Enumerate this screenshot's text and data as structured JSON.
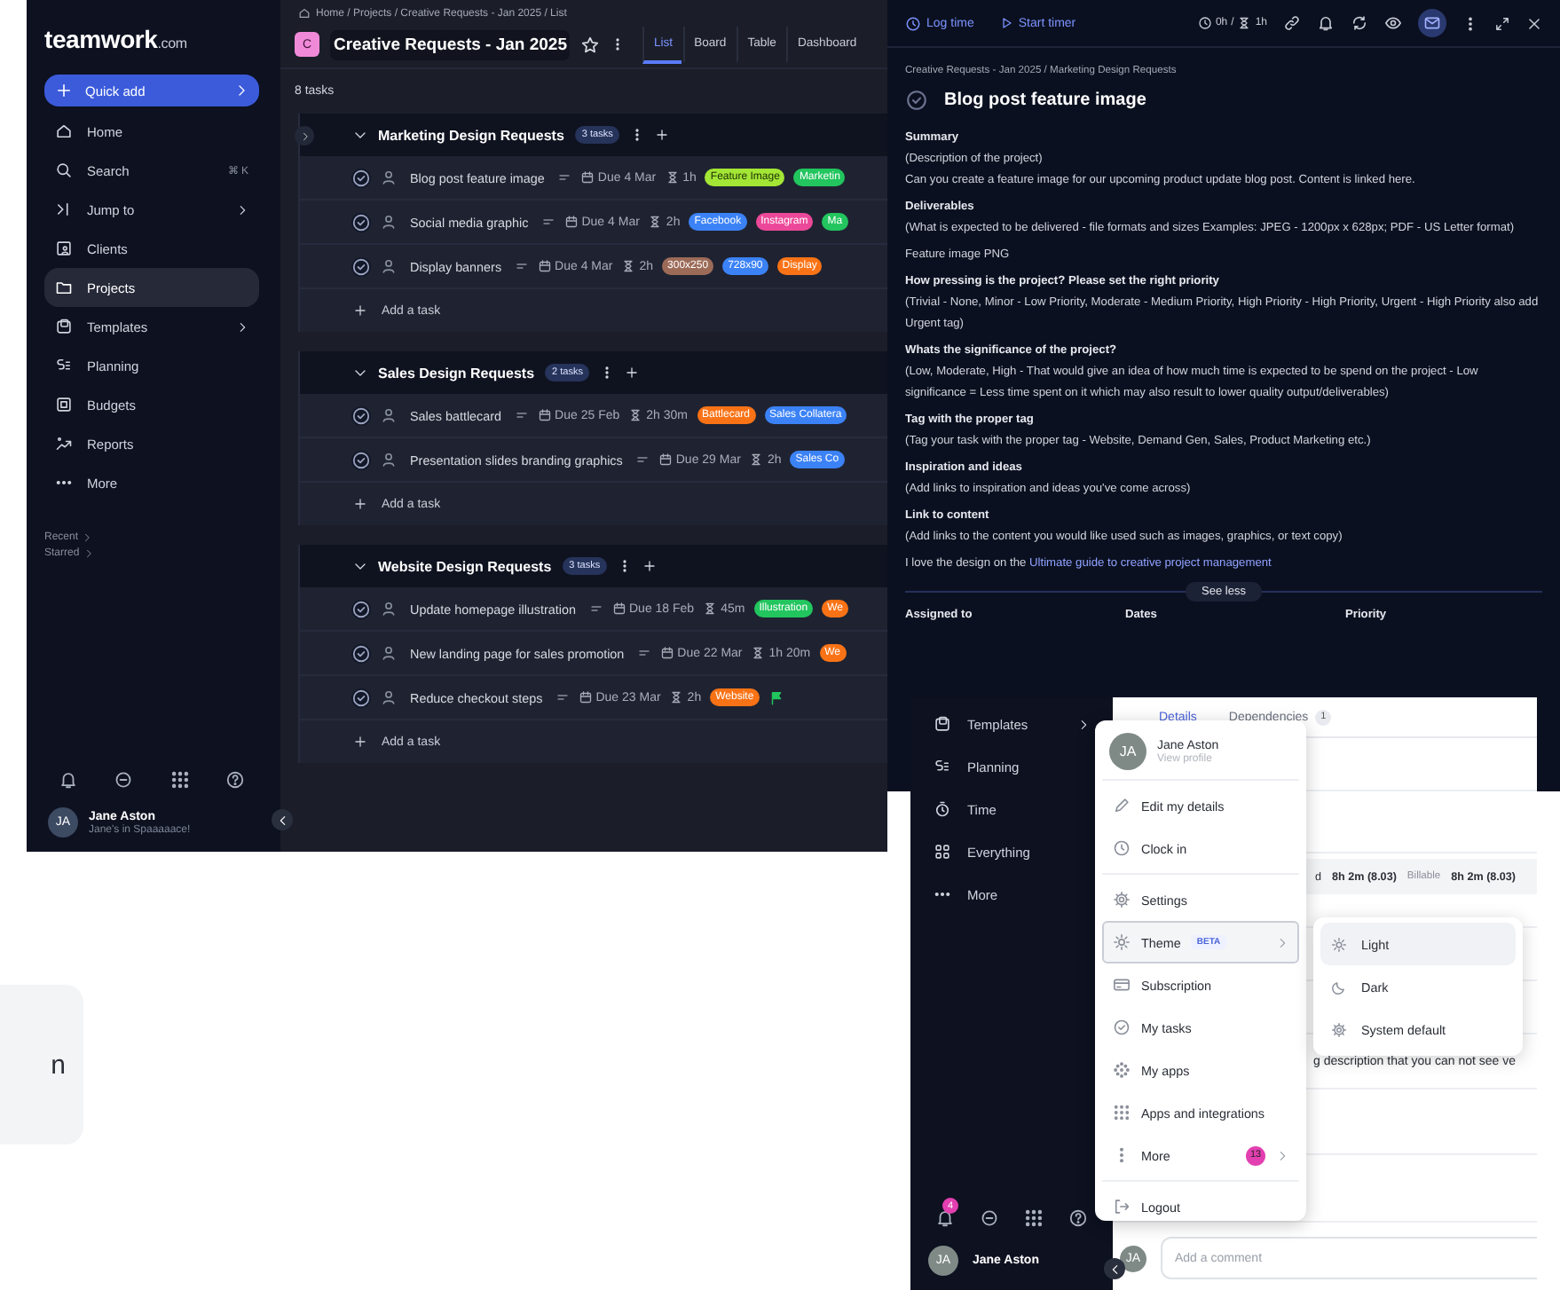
{
  "main_app": {
    "logo": {
      "name": "teamwork",
      "suffix": ".com"
    },
    "quick_add": "Quick add",
    "nav": [
      {
        "label": "Home",
        "selected": false
      },
      {
        "label": "Search",
        "shortcut": "⌘ K",
        "selected": false
      },
      {
        "label": "Jump to",
        "selected": false
      },
      {
        "label": "Clients",
        "selected": false
      },
      {
        "label": "Projects",
        "selected": true
      },
      {
        "label": "Templates",
        "selected": false
      },
      {
        "label": "Planning",
        "selected": false
      },
      {
        "label": "Budgets",
        "selected": false
      },
      {
        "label": "Reports",
        "selected": false
      },
      {
        "label": "More",
        "selected": false
      }
    ],
    "recent": "Recent",
    "starred": "Starred",
    "user": {
      "initials": "JA",
      "name": "Jane Aston",
      "status": "Jane's in Spaaaaace!"
    },
    "breadcrumb": "Home / Projects / Creative Requests - Jan 2025 / List",
    "project": {
      "badge": "C",
      "title": "Creative Requests - Jan 2025"
    },
    "tabs": [
      {
        "label": "List",
        "selected": true
      },
      {
        "label": "Board",
        "selected": false
      },
      {
        "label": "Table",
        "selected": false
      },
      {
        "label": "Dashboard",
        "selected": false
      }
    ],
    "task_count": "8 tasks",
    "groups": [
      {
        "name": "Marketing Design Requests",
        "count": "3 tasks",
        "add_task": "Add a task",
        "tasks": [
          {
            "name": "Blog post feature image",
            "due": "Due 4 Mar",
            "estimate": "1h",
            "flagged": false,
            "tags": [
              {
                "label": "Feature Image",
                "color": "#a3e635"
              },
              {
                "label": "Marketin",
                "color": "#22c55e"
              }
            ]
          },
          {
            "name": "Social media graphic",
            "due": "Due 4 Mar",
            "estimate": "2h",
            "flagged": false,
            "tags": [
              {
                "label": "Facebook",
                "color": "#3b82f6"
              },
              {
                "label": "Instagram",
                "color": "#ec4899"
              },
              {
                "label": "Ma",
                "color": "#22c55e"
              }
            ]
          },
          {
            "name": "Display banners",
            "due": "Due 4 Mar",
            "estimate": "2h",
            "flagged": false,
            "tags": [
              {
                "label": "300x250",
                "color": "#9c6b58"
              },
              {
                "label": "728x90",
                "color": "#3b82f6"
              },
              {
                "label": "Display",
                "color": "#f97316"
              }
            ]
          }
        ]
      },
      {
        "name": "Sales Design Requests",
        "count": "2 tasks",
        "add_task": "Add a task",
        "tasks": [
          {
            "name": "Sales battlecard",
            "due": "Due 25 Feb",
            "estimate": "2h 30m",
            "flagged": false,
            "tags": [
              {
                "label": "Battlecard",
                "color": "#f97316"
              },
              {
                "label": "Sales Collatera",
                "color": "#3b82f6"
              }
            ]
          },
          {
            "name": "Presentation slides branding graphics",
            "due": "Due 29 Mar",
            "estimate": "2h",
            "flagged": false,
            "tags": [
              {
                "label": "Sales Co",
                "color": "#3b82f6"
              }
            ]
          }
        ]
      },
      {
        "name": "Website Design Requests",
        "count": "3 tasks",
        "add_task": "Add a task",
        "tasks": [
          {
            "name": "Update homepage illustration",
            "due": "Due 18 Feb",
            "estimate": "45m",
            "flagged": false,
            "tags": [
              {
                "label": "Illustration",
                "color": "#22c55e"
              },
              {
                "label": "We",
                "color": "#f97316"
              }
            ]
          },
          {
            "name": "New landing page for sales promotion",
            "due": "Due 22 Mar",
            "estimate": "1h 20m",
            "flagged": false,
            "tags": [
              {
                "label": "We",
                "color": "#f97316"
              }
            ]
          },
          {
            "name": "Reduce checkout steps",
            "due": "Due 23 Mar",
            "estimate": "2h",
            "flagged": true,
            "tags": [
              {
                "label": "Website",
                "color": "#f97316"
              }
            ]
          }
        ]
      }
    ]
  },
  "task_panel": {
    "toolbar": {
      "log_time": "Log time",
      "start_timer": "Start timer",
      "logged": "0h",
      "separator": "/",
      "estimate": "1h",
      "email_on": true
    },
    "breadcrumb": "Creative Requests - Jan 2025 / Marketing Design Requests",
    "title": "Blog post feature image",
    "sections": [
      {
        "heading": "Summary",
        "lines": [
          "(Description of the project)",
          "Can you create a feature image for our upcoming product update blog post. Content is linked here."
        ]
      },
      {
        "heading": "Deliverables",
        "lines": [
          "(What is expected to be delivered - file formats and sizes Examples: JPEG - 1200px x 628px; PDF - US Letter format)"
        ]
      },
      {
        "lines": [
          "Feature image PNG"
        ]
      },
      {
        "heading": "How pressing is the project? Please set the right priority",
        "lines": [
          "(Trivial - None, Minor - Low Priority, Moderate - Medium Priority, High Priority - High Priority, Urgent - High Priority also add Urgent tag)"
        ]
      },
      {
        "heading": "Whats the significance of the project?",
        "lines": [
          "(Low, Moderate, High - That would give an idea of how much time is expected to be spend on the project - Low significance = Less time spent on it which may also result to lower quality output/deliverables)"
        ]
      },
      {
        "heading": "Tag with the proper tag",
        "lines": [
          "(Tag your task with the proper tag - Website, Demand Gen, Sales, Product Marketing etc.)"
        ]
      },
      {
        "heading": "Inspiration and ideas",
        "lines": [
          "(Add links to inspiration and ideas you've come across)"
        ]
      },
      {
        "heading": "Link to content",
        "lines": [
          "(Add links to the content you would like used such as images, graphics, or text copy)"
        ]
      }
    ],
    "closing": {
      "text": "I love the design on the ",
      "link": "Ultimate guide to creative project management"
    },
    "see_less": "See less",
    "fields": [
      "Assigned to",
      "Dates",
      "Priority"
    ]
  },
  "overlay": {
    "sidebar": [
      {
        "label": "Templates"
      },
      {
        "label": "Planning"
      },
      {
        "label": "Time"
      },
      {
        "label": "Everything"
      },
      {
        "label": "More"
      }
    ],
    "notification_count": "4",
    "user": {
      "initials": "JA",
      "name": "Jane Aston"
    },
    "panel": {
      "tabs": [
        {
          "label": "Details",
          "selected": true
        },
        {
          "label": "Dependencies",
          "count": "1",
          "selected": false
        }
      ],
      "time_row": {
        "fragment": "d",
        "logged": "8h 2m (8.03)",
        "billable_label": "Billable",
        "billable": "8h 2m (8.03)"
      },
      "description_fragment": "g description that you can not see ve",
      "comment": {
        "initials": "JA",
        "placeholder": "Add a comment"
      }
    },
    "user_menu": {
      "initials": "JA",
      "name": "Jane Aston",
      "link": "View profile",
      "items": [
        {
          "label": "Edit my details",
          "selected": false
        },
        {
          "label": "Clock in",
          "selected": false
        },
        {
          "label": "Settings",
          "selected": false
        },
        {
          "label": "Theme",
          "badge": "BETA",
          "selected": true
        },
        {
          "label": "Subscription",
          "selected": false
        },
        {
          "label": "My tasks",
          "selected": false
        },
        {
          "label": "My apps",
          "selected": false
        },
        {
          "label": "Apps and integrations",
          "selected": false
        },
        {
          "label": "More",
          "count": "13",
          "selected": false
        },
        {
          "label": "Logout",
          "selected": false
        }
      ]
    },
    "theme_menu": [
      {
        "label": "Light",
        "selected": true
      },
      {
        "label": "Dark",
        "selected": false
      },
      {
        "label": "System default",
        "selected": false
      }
    ]
  },
  "side_card": {
    "text": "n"
  }
}
